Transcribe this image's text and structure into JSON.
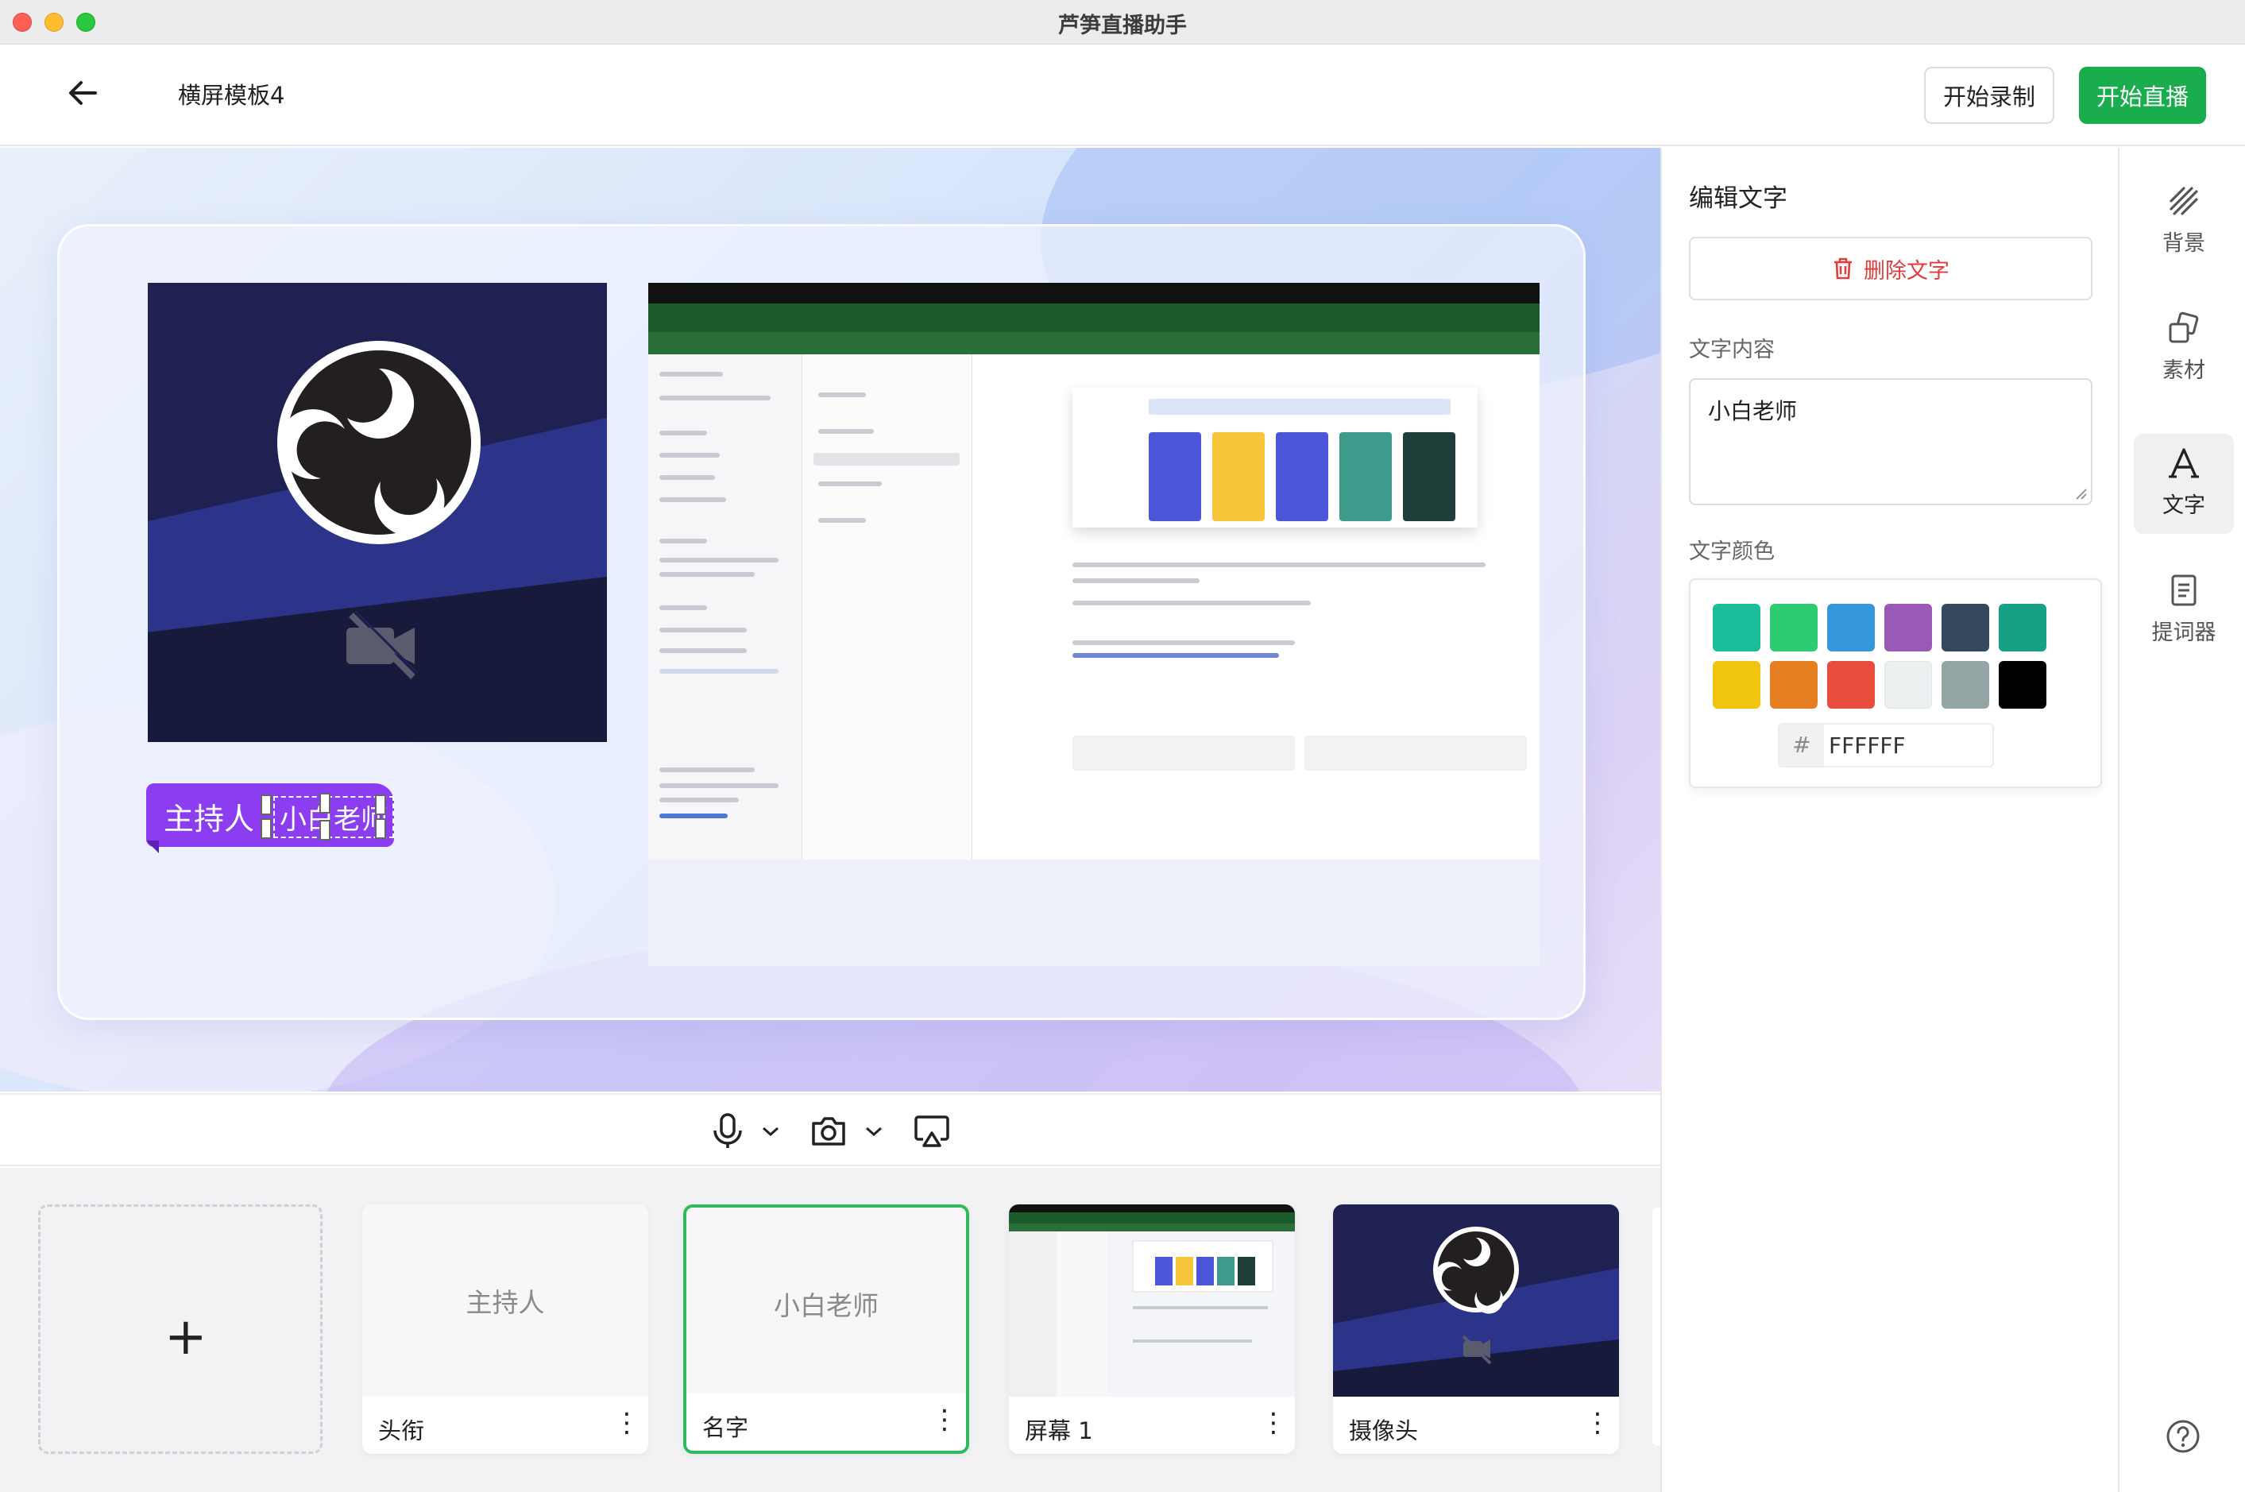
{
  "window": {
    "title": "芦笋直播助手"
  },
  "header": {
    "template_name": "横屏模板4",
    "record_label": "开始录制",
    "live_label": "开始直播"
  },
  "stage": {
    "name_tag": {
      "title": "主持人",
      "name": "小白老师"
    }
  },
  "sources": [
    {
      "label": "头衔",
      "preview_text": "主持人",
      "selected": false
    },
    {
      "label": "名字",
      "preview_text": "小白老师",
      "selected": true
    },
    {
      "label": "屏幕 1",
      "selected": false
    },
    {
      "label": "摄像头",
      "selected": false
    }
  ],
  "panel": {
    "title": "编辑文字",
    "delete_label": "删除文字",
    "content_label": "文字内容",
    "content_value": "小白老师",
    "color_label": "文字颜色",
    "hex_prefix": "#",
    "hex_value": "FFFFFF",
    "swatches": [
      "#1abc9c",
      "#2ecc71",
      "#3498db",
      "#9b59b6",
      "#34495e",
      "#16a085",
      "#f1c40f",
      "#e67e22",
      "#e74c3c",
      "#ecf0f1",
      "#95a5a6",
      "#000000"
    ]
  },
  "nav": {
    "items": [
      {
        "label": "背景",
        "icon": "background-icon"
      },
      {
        "label": "素材",
        "icon": "material-icon"
      },
      {
        "label": "文字",
        "icon": "text-icon",
        "active": true
      },
      {
        "label": "提词器",
        "icon": "teleprompter-icon"
      }
    ]
  },
  "colors": {
    "accent": "#1aad4e",
    "danger": "#e23b3b",
    "name_tag": "#8c3df2"
  }
}
